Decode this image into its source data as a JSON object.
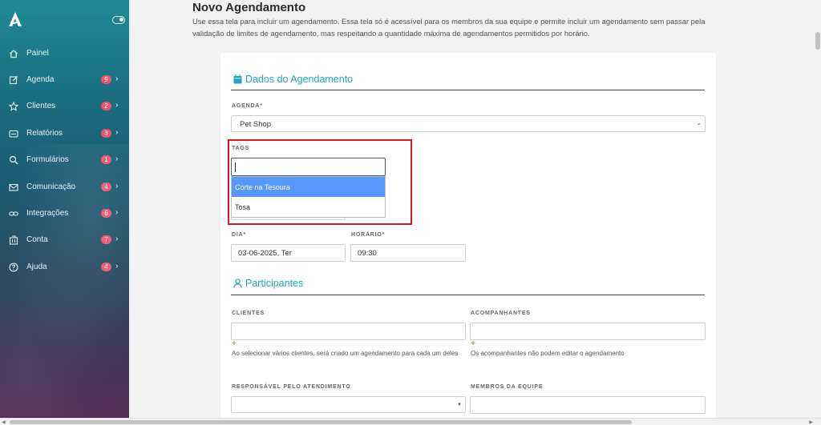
{
  "sidebar": {
    "items": [
      {
        "label": "Painel",
        "icon": "home-icon",
        "badge": null
      },
      {
        "label": "Agenda",
        "icon": "edit-icon",
        "badge": "9"
      },
      {
        "label": "Clientes",
        "icon": "star-icon",
        "badge": "2"
      },
      {
        "label": "Relatórios",
        "icon": "report-icon",
        "badge": "3"
      },
      {
        "label": "Formulários",
        "icon": "search-icon",
        "badge": "1"
      },
      {
        "label": "Comunicação",
        "icon": "mail-icon",
        "badge": "4"
      },
      {
        "label": "Integrações",
        "icon": "link-icon",
        "badge": "6"
      },
      {
        "label": "Conta",
        "icon": "building-icon",
        "badge": "7"
      },
      {
        "label": "Ajuda",
        "icon": "help-icon",
        "badge": "4"
      }
    ],
    "badge_color": "#f0526b"
  },
  "page": {
    "title": "Novo Agendamento",
    "description": "Use essa tela para incluir um agendamento. Essa tela só é acessível para os membros da sua equipe e permite incluir um agendamento sem passar pela validação de limites de agendamento, mas respeitando a quantidade máxima de agendamentos permitidos por horário."
  },
  "form": {
    "section_schedule": "Dados do Agendamento",
    "agenda_label": "AGENDA*",
    "agenda_value": "Pet Shop",
    "tags_label": "TAGS",
    "tags_search_value": "",
    "tags_options": [
      "Corte na Tesoura",
      "Tosa"
    ],
    "day_label": "DIA*",
    "day_value": "03-06-2025, Ter",
    "time_label": "HORÁRIO*",
    "time_value": "09:30",
    "section_participants": "Participantes",
    "clients_label": "CLIENTES",
    "clients_value": "",
    "clients_hint": "Ao selecionar vários clientes, será criado um agendamento para cada um deles",
    "companions_label": "ACOMPANHANTES",
    "companions_value": "",
    "companions_hint": "Os acompanhantes não podem editar o agendamento",
    "responsible_label": "RESPONSÁVEL PELO ATENDIMENTO",
    "responsible_value": "",
    "team_label": "MEMBROS DA EQUIPE",
    "team_value": "",
    "plus_symbol": "+",
    "accent_color": "#20a6b6",
    "highlight_color": "#e1141e",
    "option_active_color": "#5897fb"
  }
}
